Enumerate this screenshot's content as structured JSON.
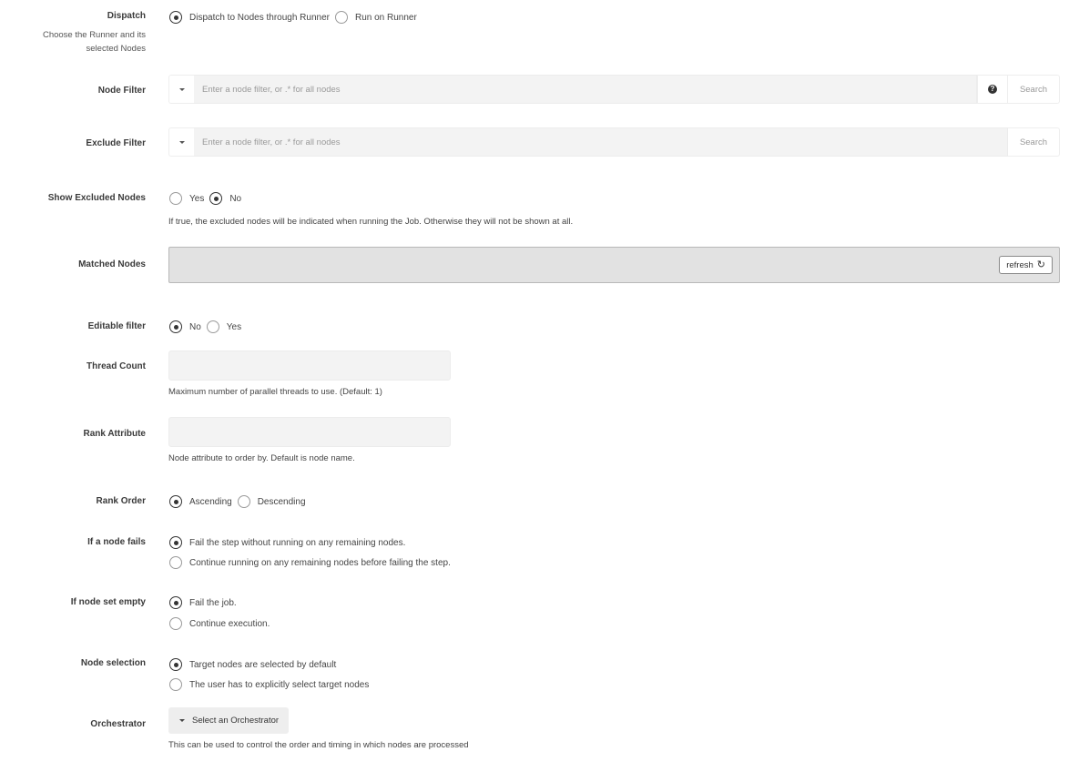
{
  "dispatch": {
    "label": "Dispatch",
    "description": "Choose the Runner and its selected Nodes",
    "options": [
      {
        "label": "Dispatch to Nodes through Runner",
        "checked": true
      },
      {
        "label": "Run on Runner",
        "checked": false
      }
    ]
  },
  "node_filter": {
    "label": "Node Filter",
    "placeholder": "Enter a node filter, or .* for all nodes",
    "value": "",
    "help_icon": "question-circle-icon",
    "search_label": "Search"
  },
  "exclude_filter": {
    "label": "Exclude Filter",
    "placeholder": "Enter a node filter, or .* for all nodes",
    "value": "",
    "search_label": "Search"
  },
  "show_excluded": {
    "label": "Show Excluded Nodes",
    "options": [
      {
        "label": "Yes",
        "checked": false
      },
      {
        "label": "No",
        "checked": true
      }
    ],
    "help": "If true, the excluded nodes will be indicated when running the Job. Otherwise they will not be shown at all."
  },
  "matched_nodes": {
    "label": "Matched Nodes",
    "refresh_label": "refresh",
    "refresh_icon": "refresh-icon"
  },
  "editable_filter": {
    "label": "Editable filter",
    "options": [
      {
        "label": "No",
        "checked": true
      },
      {
        "label": "Yes",
        "checked": false
      }
    ]
  },
  "thread_count": {
    "label": "Thread Count",
    "value": "",
    "help": "Maximum number of parallel threads to use. (Default: 1)"
  },
  "rank_attribute": {
    "label": "Rank Attribute",
    "value": "",
    "help": "Node attribute to order by. Default is node name."
  },
  "rank_order": {
    "label": "Rank Order",
    "options": [
      {
        "label": "Ascending",
        "checked": true
      },
      {
        "label": "Descending",
        "checked": false
      }
    ]
  },
  "node_fails": {
    "label": "If a node fails",
    "options": [
      {
        "label": "Fail the step without running on any remaining nodes.",
        "checked": true
      },
      {
        "label": "Continue running on any remaining nodes before failing the step.",
        "checked": false
      }
    ]
  },
  "node_set_empty": {
    "label": "If node set empty",
    "options": [
      {
        "label": "Fail the job.",
        "checked": true
      },
      {
        "label": "Continue execution.",
        "checked": false
      }
    ]
  },
  "node_selection": {
    "label": "Node selection",
    "options": [
      {
        "label": "Target nodes are selected by default",
        "checked": true
      },
      {
        "label": "The user has to explicitly select target nodes",
        "checked": false
      }
    ]
  },
  "orchestrator": {
    "label": "Orchestrator",
    "button_label": "Select an Orchestrator",
    "help": "This can be used to control the order and timing in which nodes are processed"
  }
}
